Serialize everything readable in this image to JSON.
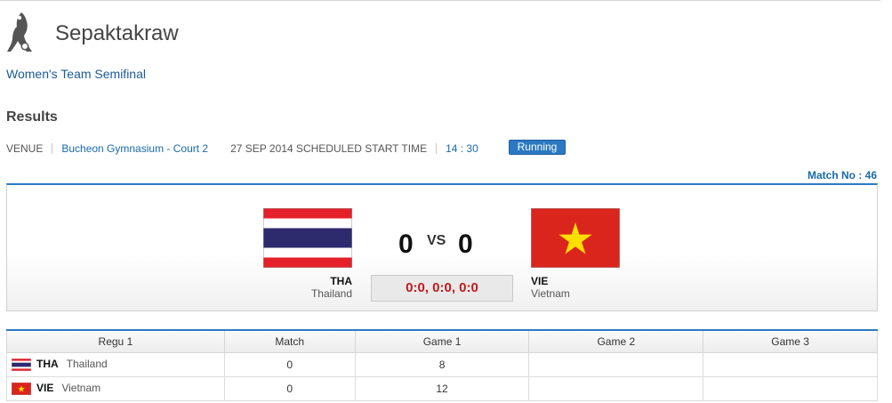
{
  "header": {
    "sport_title": "Sepaktakraw",
    "event": "Women's Team Semifinal",
    "section_title": "Results",
    "logo_icon": "sepaktakraw-pictogram-icon"
  },
  "venue": {
    "label": "VENUE",
    "name": "Bucheon Gymnasium - Court 2",
    "date_time_label": "27 SEP 2014 SCHEDULED START TIME",
    "time": "14 : 30",
    "status": "Running"
  },
  "match": {
    "match_no": "Match No : 46",
    "home": {
      "code": "THA",
      "name": "Thailand",
      "score": "0",
      "flag_icon": "thailand-flag-icon"
    },
    "away": {
      "code": "VIE",
      "name": "Vietnam",
      "score": "0",
      "flag_icon": "vietnam-flag-icon"
    },
    "vs": "VS",
    "sets": "0:0, 0:0, 0:0"
  },
  "table": {
    "headers": [
      "Regu 1",
      "Match",
      "Game 1",
      "Game 2",
      "Game 3"
    ],
    "rows": [
      {
        "code": "THA",
        "name": "Thailand",
        "match": "0",
        "game1": "8",
        "game2": "",
        "game3": ""
      },
      {
        "code": "VIE",
        "name": "Vietnam",
        "match": "0",
        "game1": "12",
        "game2": "",
        "game3": ""
      }
    ]
  },
  "colors": {
    "accent_blue": "#2b79c2",
    "link_blue": "#1a5a9a",
    "set_score_red": "#c0191d",
    "thai_red": "#e4202a",
    "thai_blue": "#2d2a6e",
    "viet_red": "#da251d",
    "viet_star": "#ffde00"
  }
}
